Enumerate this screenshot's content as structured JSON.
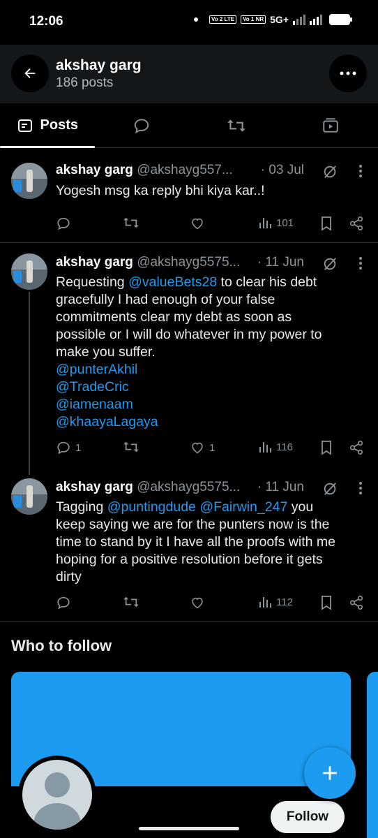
{
  "status_bar": {
    "time": "12:06",
    "sim1": "Vo 2 LTE",
    "sim2": "Vo 1 NR",
    "network": "5G+"
  },
  "header": {
    "name": "akshay garg",
    "post_count": "186 posts",
    "back_icon": "arrow-left-icon",
    "more_icon": "more-horizontal-icon"
  },
  "tabs": [
    {
      "label": "Posts",
      "icon": "posts-icon",
      "active": true
    },
    {
      "label": "",
      "icon": "reply-icon",
      "active": false
    },
    {
      "label": "",
      "icon": "retweet-icon",
      "active": false
    },
    {
      "label": "",
      "icon": "media-icon",
      "active": false
    }
  ],
  "tweets": [
    {
      "name": "akshay garg",
      "handle": "@akshayg557...",
      "date": "· 03 Jul",
      "body": [
        {
          "text": "Yogesh msg ka reply bhi kiya kar..!",
          "mention": false
        }
      ],
      "replies": "",
      "retweets": "",
      "likes": "",
      "views": "101"
    },
    {
      "name": "akshay garg",
      "handle": "@akshayg5575...",
      "date": "· 11 Jun",
      "lines": [
        [
          {
            "text": "Requesting ",
            "mention": false
          },
          {
            "text": "@valueBets28",
            "mention": true
          },
          {
            "text": " to clear his debt",
            "mention": false
          }
        ],
        [
          {
            "text": "gracefully I had enough of your false",
            "mention": false
          }
        ],
        [
          {
            "text": "commitments clear my debt as soon as",
            "mention": false
          }
        ],
        [
          {
            "text": "possible or I will do whatever in my power to",
            "mention": false
          }
        ],
        [
          {
            "text": "make you suffer.",
            "mention": false
          }
        ],
        [
          {
            "text": "@punterAkhil",
            "mention": true
          }
        ],
        [
          {
            "text": "@TradeCric",
            "mention": true
          }
        ],
        [
          {
            "text": "@iamenaam",
            "mention": true
          }
        ],
        [
          {
            "text": "@khaayaLagaya",
            "mention": true
          }
        ]
      ],
      "replies": "1",
      "retweets": "",
      "likes": "1",
      "views": "116"
    },
    {
      "name": "akshay garg",
      "handle": "@akshayg5575...",
      "date": "· 11 Jun",
      "lines": [
        [
          {
            "text": "Tagging ",
            "mention": false
          },
          {
            "text": "@puntingdude",
            "mention": true
          },
          {
            "text": " ",
            "mention": false
          },
          {
            "text": "@Fairwin_247",
            "mention": true
          },
          {
            "text": " you",
            "mention": false
          }
        ],
        [
          {
            "text": "keep saying we are for the punters now is the",
            "mention": false
          }
        ],
        [
          {
            "text": "time to stand by it I have all the proofs with me",
            "mention": false
          }
        ],
        [
          {
            "text": "hoping for a positive resolution before it gets",
            "mention": false
          }
        ],
        [
          {
            "text": "dirty",
            "mention": false
          }
        ]
      ],
      "replies": "",
      "retweets": "",
      "likes": "",
      "views": "112"
    }
  ],
  "who_to_follow": {
    "title": "Who to follow",
    "follow_label": "Follow"
  },
  "colors": {
    "accent": "#1d9bf0",
    "background": "#000000",
    "header_bg": "#14171a",
    "muted_text": "#8b9298"
  }
}
